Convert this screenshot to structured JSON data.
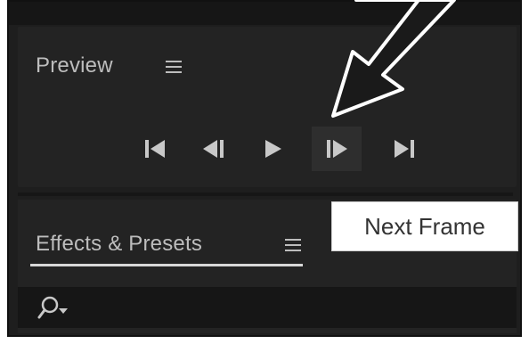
{
  "preview_panel": {
    "title": "Preview",
    "controls": [
      {
        "name": "first-frame-button",
        "icon": "skip-to-start-icon"
      },
      {
        "name": "previous-frame-button",
        "icon": "step-back-icon"
      },
      {
        "name": "play-button",
        "icon": "play-icon"
      },
      {
        "name": "next-frame-button",
        "icon": "step-forward-icon"
      },
      {
        "name": "last-frame-button",
        "icon": "skip-to-end-icon"
      }
    ]
  },
  "effects_panel": {
    "tab_label": "Effects & Presets",
    "search_icon": "search-dropdown-icon"
  },
  "tooltip": {
    "text": "Next Frame"
  },
  "colors": {
    "panel_bg": "#232323",
    "control_color": "#c8c8c8",
    "tooltip_bg": "#ffffff"
  }
}
